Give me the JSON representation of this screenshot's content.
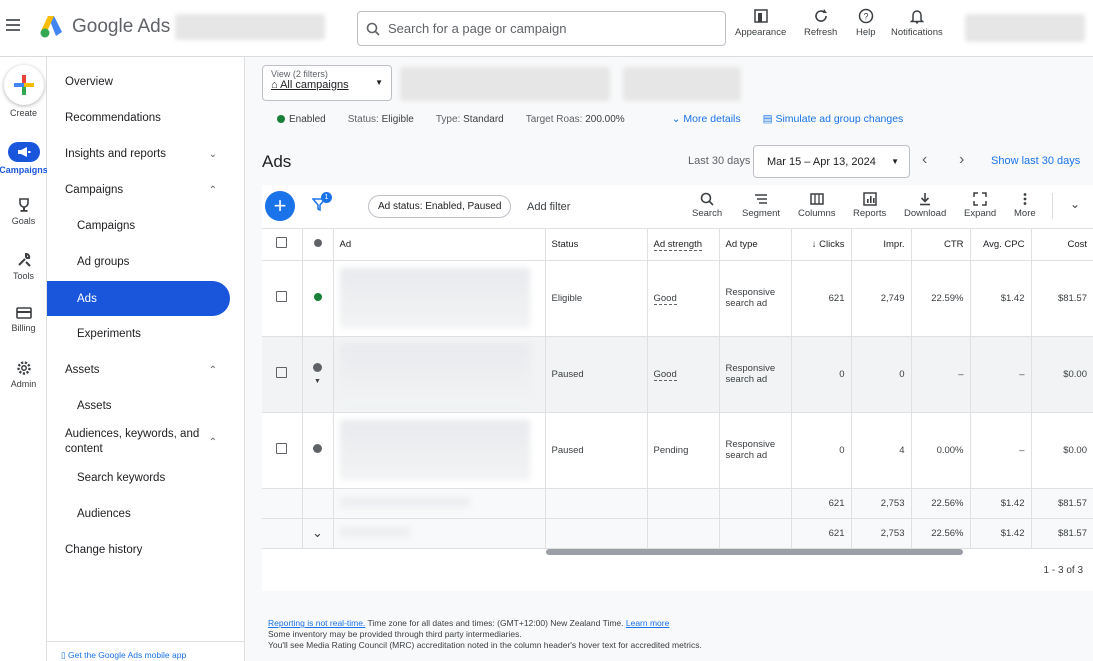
{
  "header": {
    "app_title": "Google Ads",
    "search_placeholder": "Search for a page or campaign",
    "tools": [
      {
        "label": "Appearance",
        "icon": "appearance-icon"
      },
      {
        "label": "Refresh",
        "icon": "refresh-icon"
      },
      {
        "label": "Help",
        "icon": "help-icon"
      },
      {
        "label": "Notifications",
        "icon": "bell-icon"
      }
    ]
  },
  "rail": [
    {
      "label": "Create",
      "icon": "plus-icon"
    },
    {
      "label": "Campaigns",
      "icon": "megaphone-icon"
    },
    {
      "label": "Goals",
      "icon": "trophy-icon"
    },
    {
      "label": "Tools",
      "icon": "wrench-icon"
    },
    {
      "label": "Billing",
      "icon": "card-icon"
    },
    {
      "label": "Admin",
      "icon": "gear-icon"
    }
  ],
  "sidebar": {
    "items": [
      {
        "label": "Overview"
      },
      {
        "label": "Recommendations"
      },
      {
        "label": "Insights and reports"
      },
      {
        "label": "Campaigns"
      },
      {
        "label": "Campaigns"
      },
      {
        "label": "Ad groups"
      },
      {
        "label": "Ads"
      },
      {
        "label": "Experiments"
      },
      {
        "label": "Assets"
      },
      {
        "label": "Assets"
      },
      {
        "label": "Audiences, keywords, and content"
      },
      {
        "label": "Search keywords"
      },
      {
        "label": "Audiences"
      },
      {
        "label": "Change history"
      }
    ],
    "bottom_link": "Get the Google Ads mobile app"
  },
  "view_filter": {
    "caption": "View (2 filters)",
    "value": "All campaigns"
  },
  "status_bar": {
    "enabled": "Enabled",
    "status_label": "Status:",
    "status_value": "Eligible",
    "type_label": "Type:",
    "type_value": "Standard",
    "roas_label": "Target Roas:",
    "roas_value": "200.00%",
    "more_details": "More details",
    "simulate": "Simulate ad group changes"
  },
  "page": {
    "title": "Ads",
    "date_label": "Last 30 days",
    "date_range": "Mar 15 – Apr 13, 2024",
    "show_last": "Show last 30 days"
  },
  "toolbar": {
    "filter_count": "1",
    "filter_chip": "Ad status: Enabled, Paused",
    "add_filter": "Add filter",
    "buttons": [
      "Search",
      "Segment",
      "Columns",
      "Reports",
      "Download",
      "Expand",
      "More"
    ]
  },
  "table": {
    "headers": [
      "Ad",
      "Status",
      "Ad strength",
      "Ad type",
      "Clicks",
      "Impr.",
      "CTR",
      "Avg. CPC",
      "Cost"
    ],
    "rows": [
      {
        "status": "Eligible",
        "strength": "Good",
        "type": "Responsive search ad",
        "clicks": "621",
        "impr": "2,749",
        "ctr": "22.59%",
        "cpc": "$1.42",
        "cost": "$81.57"
      },
      {
        "status": "Paused",
        "strength": "Good",
        "type": "Responsive search ad",
        "clicks": "0",
        "impr": "0",
        "ctr": "–",
        "cpc": "–",
        "cost": "$0.00"
      },
      {
        "status": "Paused",
        "strength": "Pending",
        "type": "Responsive search ad",
        "clicks": "0",
        "impr": "4",
        "ctr": "0.00%",
        "cpc": "–",
        "cost": "$0.00"
      }
    ],
    "totals": [
      {
        "clicks": "621",
        "impr": "2,753",
        "ctr": "22.56%",
        "cpc": "$1.42",
        "cost": "$81.57"
      },
      {
        "clicks": "621",
        "impr": "2,753",
        "ctr": "22.56%",
        "cpc": "$1.42",
        "cost": "$81.57"
      }
    ],
    "pager": "1 - 3 of 3"
  },
  "footer": {
    "link1": "Reporting is not real-time.",
    "line1": " Time zone for all dates and times: (GMT+12:00) New Zealand Time. ",
    "link2": "Learn more",
    "line2": "Some inventory may be provided through third party intermediaries.",
    "line3": "You'll see Media Rating Council (MRC) accreditation noted in the column header's hover text for accredited metrics."
  },
  "colors": {
    "accent": "#1a73e8",
    "active_nav": "#1a56db",
    "enabled_green": "#188038"
  }
}
